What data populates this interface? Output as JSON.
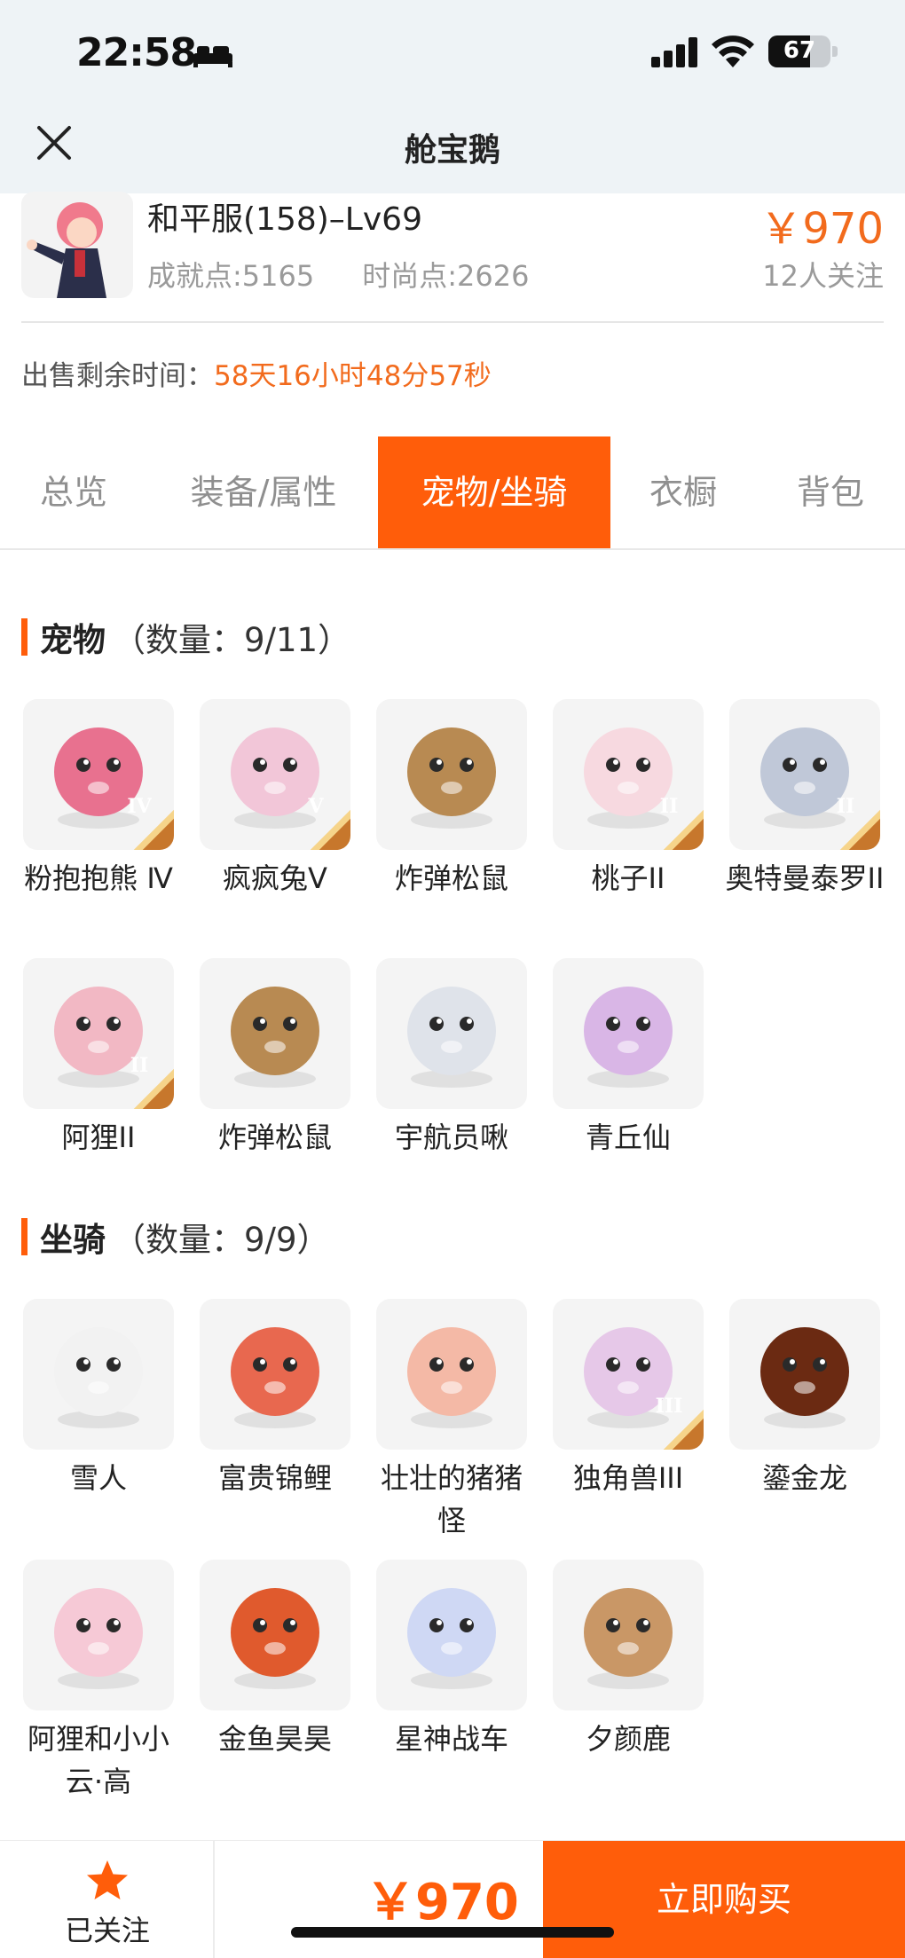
{
  "status_bar": {
    "time": "22:58",
    "battery": "67",
    "battery_level": 0.67
  },
  "nav": {
    "title": "舱宝鹅"
  },
  "product": {
    "name": "和平服(158)–Lv69",
    "achievement": "成就点:5165",
    "fashion": "时尚点:2626",
    "price": "￥970",
    "followers": "12人关注"
  },
  "sale_time": {
    "label": "出售剩余时间：",
    "value": "58天16小时48分57秒"
  },
  "tabs": [
    {
      "label": "总览",
      "active": false
    },
    {
      "label": "装备/属性",
      "active": false
    },
    {
      "label": "宠物/坐骑",
      "active": true
    },
    {
      "label": "衣橱",
      "active": false
    },
    {
      "label": "背包",
      "active": false
    }
  ],
  "pets": {
    "title": "宠物",
    "count": "（数量：9/11）",
    "items": [
      {
        "name": "粉抱抱熊 Ⅳ",
        "badge": "IV",
        "icon": "pink-bear-icon",
        "color": "#e8718f"
      },
      {
        "name": "疯疯兔V",
        "badge": "V",
        "icon": "rabbit-icon",
        "color": "#f2c6d8"
      },
      {
        "name": "炸弹松鼠",
        "badge": "",
        "icon": "squirrel-icon",
        "color": "#b88a52"
      },
      {
        "name": "桃子II",
        "badge": "II",
        "icon": "cat-bow-icon",
        "color": "#f7d9e0"
      },
      {
        "name": "奥特曼泰罗II",
        "badge": "II",
        "icon": "ultraman-icon",
        "color": "#c0c8d8"
      },
      {
        "name": "阿狸II",
        "badge": "II",
        "icon": "lion-dance-icon",
        "color": "#f2b8c4"
      },
      {
        "name": "炸弹松鼠",
        "badge": "",
        "icon": "squirrel-icon",
        "color": "#b88a52"
      },
      {
        "name": "宇航员啾",
        "badge": "",
        "icon": "astronaut-cow-icon",
        "color": "#dfe3ea"
      },
      {
        "name": "青丘仙",
        "badge": "",
        "icon": "fox-fairy-icon",
        "color": "#d9b6e6"
      }
    ]
  },
  "mounts": {
    "title": "坐骑",
    "count": "（数量：9/9）",
    "items": [
      {
        "name": "雪人",
        "badge": "",
        "icon": "snowman-icon",
        "color": "#f2f2f2"
      },
      {
        "name": "富贵锦鲤",
        "badge": "",
        "icon": "koi-icon",
        "color": "#e8684f"
      },
      {
        "name": "壮壮的猪猪怪",
        "badge": "",
        "icon": "pig-icon",
        "color": "#f4b9a6"
      },
      {
        "name": "独角兽III",
        "badge": "III",
        "icon": "unicorn-icon",
        "color": "#e6c8e8"
      },
      {
        "name": "鎏金龙",
        "badge": "",
        "icon": "dragon-icon",
        "color": "#6b2a12"
      },
      {
        "name": "阿狸和小小云·高",
        "badge": "",
        "icon": "ali-cloud-icon",
        "color": "#f6c9d6"
      },
      {
        "name": "金鱼昊昊",
        "badge": "",
        "icon": "goldfish-icon",
        "color": "#e05a2d"
      },
      {
        "name": "星神战车",
        "badge": "",
        "icon": "star-horse-icon",
        "color": "#cfd8f4"
      },
      {
        "name": "夕颜鹿",
        "badge": "",
        "icon": "deer-icon",
        "color": "#c99766"
      }
    ]
  },
  "bottom": {
    "follow_label": "已关注",
    "price": "￥970",
    "buy_label": "立即购买"
  },
  "colors": {
    "accent": "#ff5d0a",
    "price": "#f26b1d"
  }
}
